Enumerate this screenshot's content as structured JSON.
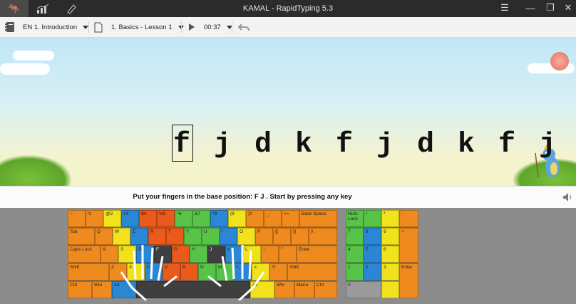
{
  "window": {
    "title": "KAMAL - RapidTyping 5.3"
  },
  "toolbar": {
    "course": "EN 1. Introduction",
    "lesson": "1. Basics - Lesson 1",
    "time": "00:37"
  },
  "lesson": {
    "letters": [
      "f",
      "j",
      "d",
      "k",
      "f",
      "j",
      "d",
      "k",
      "f",
      "j"
    ],
    "current_index": 0
  },
  "instruction": "Put your fingers in the base position:  F  J .  Start by pressing any key",
  "keyboard": {
    "row1": [
      "~`",
      "!1",
      "@2",
      "#3",
      "$4",
      "%5",
      "^6",
      "&7",
      "*8",
      "(9",
      ")0",
      "_-",
      "+=",
      "Back Space"
    ],
    "row2": [
      "Tab",
      "Q",
      "W",
      "E",
      "R",
      "T",
      "Y",
      "U",
      "I",
      "O",
      "P",
      "{[",
      "}]",
      "|\\"
    ],
    "row3": [
      "Caps Lock",
      "A",
      "S",
      "D",
      "F",
      "G",
      "H",
      "J",
      "K",
      "L",
      ":;",
      "\"'",
      "Enter"
    ],
    "row4": [
      "Shift",
      "Z",
      "X",
      "C",
      "V",
      "B",
      "N",
      "M",
      "<,",
      ">.",
      "?/",
      "Shift"
    ],
    "row5": [
      "Ctrl",
      "Win",
      "Alt",
      "",
      "Alt",
      "Win",
      "Menu",
      "Ctrl"
    ],
    "numpad": [
      "Num Lock",
      "/",
      "*",
      "-",
      "7",
      "8",
      "9",
      "+",
      "4",
      "5",
      "6",
      "1",
      "2",
      "3",
      "Enter",
      "0",
      "."
    ]
  }
}
